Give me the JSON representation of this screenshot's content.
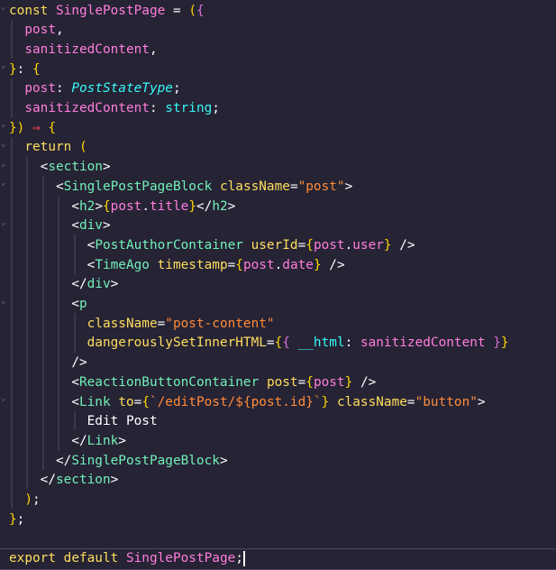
{
  "editor": {
    "language": "javascript-react",
    "theme_colors": {
      "background": "#262335",
      "keyword": "#fede5d",
      "identifier": "#ff7edb",
      "tag": "#72f1b8",
      "string": "#ff8b39",
      "type": "#36f9f6"
    }
  },
  "lines": [
    {
      "text": "const SinglePostPage = ({"
    },
    {
      "text": "  post,"
    },
    {
      "text": "  sanitizedContent,"
    },
    {
      "text": "}: {"
    },
    {
      "text": "  post: PostStateType;"
    },
    {
      "text": "  sanitizedContent: string;"
    },
    {
      "text": "}) ⇒ {"
    },
    {
      "text": "  return ("
    },
    {
      "text": "    <section>"
    },
    {
      "text": "      <SinglePostPageBlock className=\"post\">"
    },
    {
      "text": "        <h2>{post.title}</h2>"
    },
    {
      "text": "        <div>"
    },
    {
      "text": "          <PostAuthorContainer userId={post.user} />"
    },
    {
      "text": "          <TimeAgo timestamp={post.date} />"
    },
    {
      "text": "        </div>"
    },
    {
      "text": "        <p"
    },
    {
      "text": "          className=\"post-content\""
    },
    {
      "text": "          dangerouslySetInnerHTML={{ __html: sanitizedContent }}"
    },
    {
      "text": "        />"
    },
    {
      "text": "        <ReactionButtonContainer post={post} />"
    },
    {
      "text": "        <Link to={`/editPost/${post.id}`} className=\"button\">"
    },
    {
      "text": "          Edit Post"
    },
    {
      "text": "        </Link>"
    },
    {
      "text": "      </SinglePostPageBlock>"
    },
    {
      "text": "    </section>"
    },
    {
      "text": "  );"
    },
    {
      "text": "};"
    },
    {
      "text": ""
    },
    {
      "text": "export default SinglePostPage;"
    }
  ]
}
